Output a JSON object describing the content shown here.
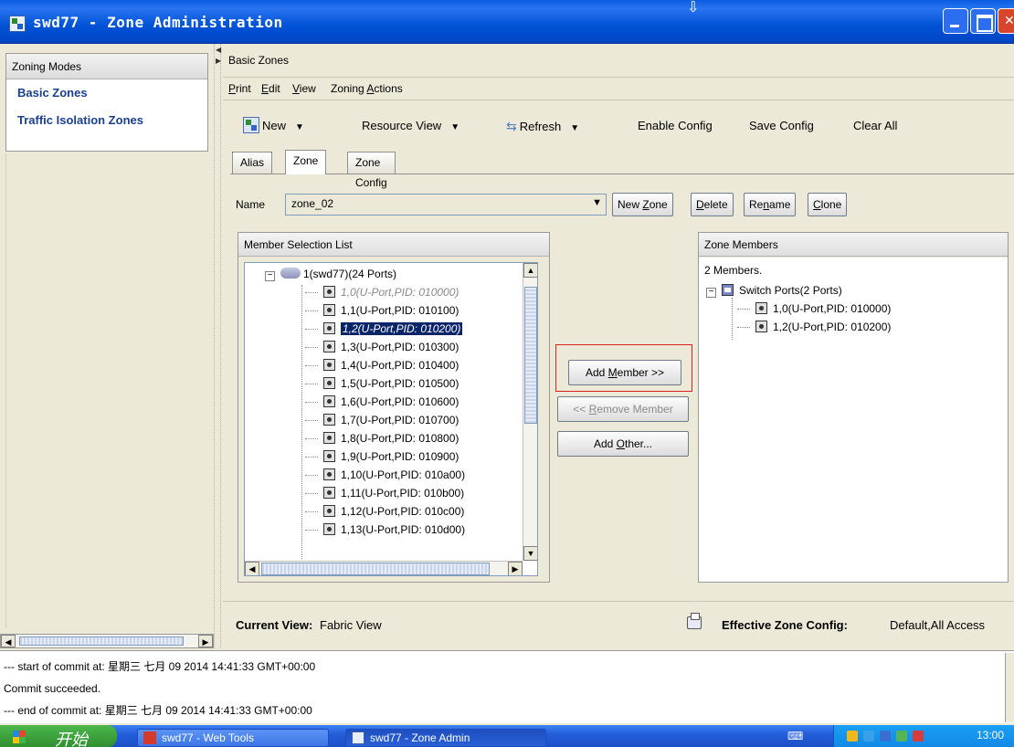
{
  "window": {
    "title": "swd77 - Zone Administration",
    "controls": {
      "minimize": "minimize",
      "maximize": "maximize",
      "close": "close"
    }
  },
  "zoning_modes": {
    "header": "Zoning Modes",
    "items": [
      {
        "label": "Basic Zones"
      },
      {
        "label": "Traffic Isolation Zones"
      }
    ]
  },
  "basic_zones": {
    "title": "Basic Zones",
    "menu": [
      {
        "label": "Print",
        "mnemonic": "P"
      },
      {
        "label": "Edit",
        "mnemonic": "E"
      },
      {
        "label": "View",
        "mnemonic": "V"
      },
      {
        "label": "Zoning Actions",
        "mnemonic": "A"
      }
    ],
    "toolbar": {
      "new": "New",
      "resource_view": "Resource View",
      "refresh": "Refresh",
      "enable_config": "Enable Config",
      "save_config": "Save Config",
      "clear_all": "Clear All"
    },
    "tabs": [
      {
        "label": "Alias",
        "active": false
      },
      {
        "label": "Zone",
        "active": true
      },
      {
        "label": "Zone Config",
        "active": false
      }
    ],
    "name_label": "Name",
    "name_value": "zone_02",
    "zone_buttons": {
      "new_zone": "New Zone",
      "delete": "Delete",
      "rename": "Rename",
      "clone": "Clone"
    },
    "member_selection": {
      "header": "Member Selection List",
      "root": "1(swd77)(24 Ports)",
      "ports": [
        {
          "label": "1,0(U-Port,PID: 010000)",
          "state": "disabled"
        },
        {
          "label": "1,1(U-Port,PID: 010100)",
          "state": "normal"
        },
        {
          "label": "1,2(U-Port,PID: 010200)",
          "state": "selected"
        },
        {
          "label": "1,3(U-Port,PID: 010300)",
          "state": "normal"
        },
        {
          "label": "1,4(U-Port,PID: 010400)",
          "state": "normal"
        },
        {
          "label": "1,5(U-Port,PID: 010500)",
          "state": "normal"
        },
        {
          "label": "1,6(U-Port,PID: 010600)",
          "state": "normal"
        },
        {
          "label": "1,7(U-Port,PID: 010700)",
          "state": "normal"
        },
        {
          "label": "1,8(U-Port,PID: 010800)",
          "state": "normal"
        },
        {
          "label": "1,9(U-Port,PID: 010900)",
          "state": "normal"
        },
        {
          "label": "1,10(U-Port,PID: 010a00)",
          "state": "normal"
        },
        {
          "label": "1,11(U-Port,PID: 010b00)",
          "state": "normal"
        },
        {
          "label": "1,12(U-Port,PID: 010c00)",
          "state": "normal"
        },
        {
          "label": "1,13(U-Port,PID: 010d00)",
          "state": "normal"
        }
      ]
    },
    "actions": {
      "add_member": "Add Member >>",
      "remove_member": "<< Remove Member",
      "add_other": "Add Other..."
    },
    "zone_members": {
      "header": "Zone Members",
      "count": "2 Members.",
      "group": "Switch Ports(2 Ports)",
      "members": [
        {
          "label": "1,0(U-Port,PID: 010000)"
        },
        {
          "label": "1,2(U-Port,PID: 010200)"
        }
      ]
    },
    "status": {
      "current_view_label": "Current View:",
      "current_view_value": "Fabric View",
      "effective_label": "Effective Zone Config:",
      "effective_value": "Default,All Access"
    }
  },
  "log": [
    "--- start of commit at: 星期三 七月 09 2014 14:41:33 GMT+00:00",
    "Commit succeeded.",
    "--- end of commit at: 星期三 七月 09 2014 14:41:33 GMT+00:00"
  ],
  "taskbar": {
    "start_label": "开始",
    "tasks": [
      {
        "label": "swd77 - Web Tools"
      },
      {
        "label": "swd77 - Zone Admin"
      }
    ],
    "clock": "13:00"
  },
  "colors": {
    "title_bar": "#0052d6",
    "selection": "#0a246a",
    "highlight_border": "#e02020",
    "mode_link": "#1a3f8f"
  }
}
